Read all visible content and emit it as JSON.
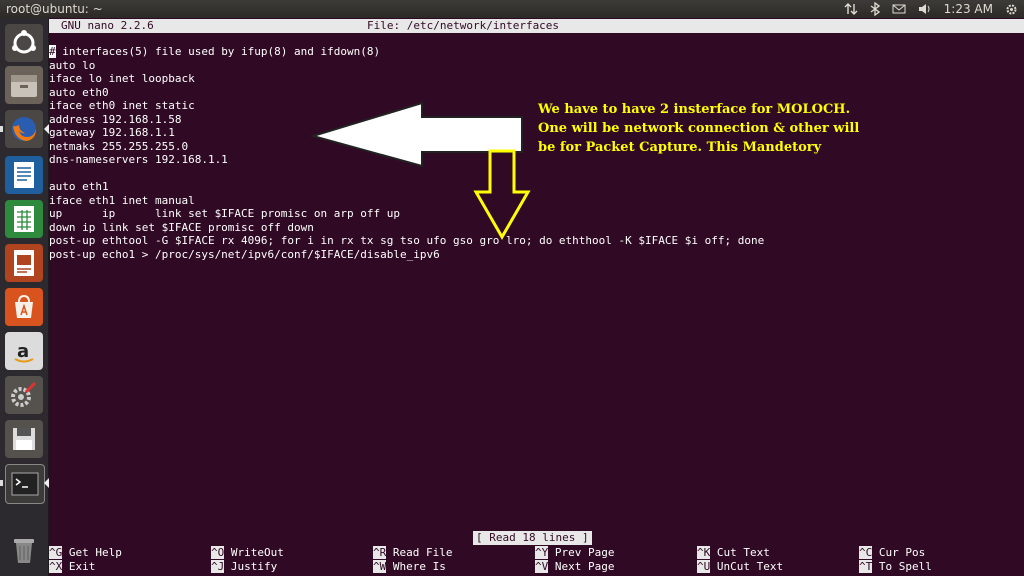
{
  "window": {
    "title": "root@ubuntu: ~"
  },
  "tray": {
    "clock": "1:23 AM"
  },
  "launcher": {
    "items": [
      "ubuntu-dash",
      "files",
      "firefox",
      "libreoffice-writer",
      "libreoffice-calc",
      "libreoffice-impress",
      "software-center",
      "amazon",
      "system-settings",
      "disk-drive",
      "terminal",
      "trash"
    ]
  },
  "nano": {
    "version": "GNU nano 2.2.6",
    "file": "File: /etc/network/interfaces",
    "lines": [
      "# interfaces(5) file used by ifup(8) and ifdown(8)",
      "auto lo",
      "iface lo inet loopback",
      "auto eth0",
      "iface eth0 inet static",
      "address 192.168.1.58",
      "gateway 192.168.1.1",
      "netmaks 255.255.255.0",
      "dns-nameservers 192.168.1.1",
      "",
      "auto eth1",
      "iface eth1 inet manual",
      "up      ip      link set $IFACE promisc on arp off up",
      "down ip link set $IFACE promisc off down",
      "post-up ethtool -G $IFACE rx 4096; for i in rx tx sg tso ufo gso gro lro; do eththool -K $IFACE $i off; done",
      "post-up echo1 > /proc/sys/net/ipv6/conf/$IFACE/disable_ipv6"
    ],
    "status": "[ Read 18 lines ]",
    "shortcuts_row1": [
      {
        "key": "^G",
        "label": "Get Help"
      },
      {
        "key": "^O",
        "label": "WriteOut"
      },
      {
        "key": "^R",
        "label": "Read File"
      },
      {
        "key": "^Y",
        "label": "Prev Page"
      },
      {
        "key": "^K",
        "label": "Cut Text"
      },
      {
        "key": "^C",
        "label": "Cur Pos"
      }
    ],
    "shortcuts_row2": [
      {
        "key": "^X",
        "label": "Exit"
      },
      {
        "key": "^J",
        "label": "Justify"
      },
      {
        "key": "^W",
        "label": "Where Is"
      },
      {
        "key": "^V",
        "label": "Next Page"
      },
      {
        "key": "^U",
        "label": "UnCut Text"
      },
      {
        "key": "^T",
        "label": "To Spell"
      }
    ]
  },
  "annotation": {
    "text": "We have to have 2 insterface for MOLOCH. One will be network connection & other will be for Packet Capture. This Mandetory",
    "color": "#ffff00"
  }
}
